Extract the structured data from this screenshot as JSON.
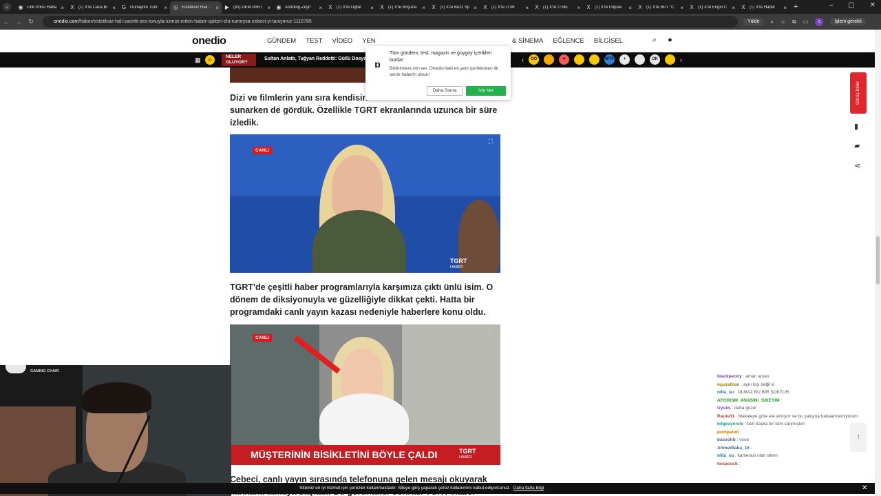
{
  "browser": {
    "tabs": [
      {
        "icon": "◉",
        "title": "Link Polisi Haba"
      },
      {
        "icon": "X",
        "title": "(1) X'te Caca Bi"
      },
      {
        "icon": "G",
        "title": "Günaydın Türk"
      },
      {
        "icon": "◎",
        "title": "Estetiksiz Hali ...",
        "active": true
      },
      {
        "icon": "▶",
        "title": "(91) DEM PART"
      },
      {
        "icon": "◉",
        "title": "Astrolog-Zeyn"
      },
      {
        "icon": "X",
        "title": "(1) X'te Dijital"
      },
      {
        "icon": "X",
        "title": "(1) X'te Boşuna"
      },
      {
        "icon": "X",
        "title": "(1) X'te Buzz Sp"
      },
      {
        "icon": "X",
        "title": "(1) X'te ⭘ Mi"
      },
      {
        "icon": "X",
        "title": "(1) X'te ⭘ Mu"
      },
      {
        "icon": "X",
        "title": "(1) X'te Popule"
      },
      {
        "icon": "X",
        "title": "(1) X'te BPT \"C"
      },
      {
        "icon": "X",
        "title": "(1) X'te Engin C"
      },
      {
        "icon": "X",
        "title": "(1) X'te Haber"
      }
    ],
    "new_tab": "+",
    "url_domain": "onedio.com",
    "url_path": "/haber/estetiksiz-hali-sasirtti-ses-tonuyla-icimizi-eriten-haber-spikeri-ela-rumeysa-cebeci-yi-taniyoruz-1115785",
    "upload_label": "Yükle",
    "profile_initial": "c",
    "pending_label": "İşlem gerekli"
  },
  "site": {
    "logo": "onedio",
    "menu_left": [
      "GÜNDEM",
      "TEST",
      "VİDEO",
      "YEN"
    ],
    "menu_right": [
      "& SİNEMA",
      "EĞLENCE",
      "BİLGİSEL"
    ],
    "neler_label": "NELER OLUYOR?",
    "ticker": "Sultan Anlattı, Tuğyan Reddetti: Güllü Dosyasını",
    "emojis": [
      {
        "label": "OO",
        "color": "#f7c800"
      },
      {
        "label": "",
        "color": "#f7a800"
      },
      {
        "label": "♥",
        "color": "#f25a5a"
      },
      {
        "label": "",
        "color": "#f7c800"
      },
      {
        "label": "",
        "color": "#f7c800"
      },
      {
        "label": "WTF",
        "color": "#2a7fd4"
      },
      {
        "label": "+",
        "color": "#e8e8e8"
      },
      {
        "label": "",
        "color": "#e8e8e8"
      },
      {
        "label": "OK",
        "color": "#e8e8e8"
      },
      {
        "label": "",
        "color": "#f7c800"
      }
    ]
  },
  "popup": {
    "title": "Tüm gündem, test, magazin ve goygoy içerikleri burda!",
    "text": "Bildirimlere izin ver, Onedio'daki en yeni içeriklerden ilk senin haberin olsun!",
    "later_label": "Daha Sonra",
    "allow_label": "İzin Ver"
  },
  "article": {
    "para1": "Dizi ve filmlerin yanı sıra kendisin... sunarken de gördük. Özellikle TGRT ekranlarında uzunca bir süre izledik.",
    "para1_lines": [
      "Dizi ve filmlerin yanı sıra kendisin",
      "sunarken de gördük. Özellikle TGRT ekranlarında uzunca bir süre",
      "izledik."
    ],
    "image1": {
      "badge": "CANLI",
      "channel": "TGRT",
      "channel_sub": "HABER"
    },
    "para2_lines": [
      "TGRT'de çeşitli haber programlarıyla karşımıza çıktı ünlü isim. O",
      "dönem de diksiyonuyla ve güzelliğiyle dikkat çekti. Hatta bir",
      "programdaki canlı yayın kazası nedeniyle haberlere konu oldu."
    ],
    "image2": {
      "badge": "CANLI",
      "banner": "MÜŞTERİNİN BİSİKLETİNİ BÖYLE ÇALDI",
      "channel": "TGRT",
      "channel_sub": "HABER"
    },
    "para3_lines": [
      "Cebeci, canlı yayın sırasında telefonuna gelen mesajı okuyarak",
      "kahkaha atmaya başladı. Bu görüntüler sonrası TGRT Haber"
    ]
  },
  "sidebar": {
    "feedback_label": "Görüş Bildir"
  },
  "stream": {
    "brand_line1": "GAMING CHAIR"
  },
  "chat": [
    {
      "user": "blackpeony",
      "color": "#7a3fb0",
      "msg": "aman aman"
    },
    {
      "user": "oguzathan",
      "color": "#a08000",
      "msg": "aynı kişi değil ki"
    },
    {
      "user": "nilla_su",
      "color": "#2a6fb0",
      "msg": "OLMAZ BU BİR ŞOKTUR"
    },
    {
      "user": "AFORISM_ANASINI_SIKEYIM",
      "color": "#1ea01e",
      "msg": ""
    },
    {
      "user": "Uyuks",
      "color": "#8a3fc0",
      "msg": "daha güzel"
    },
    {
      "user": "Raute31",
      "color": "#c0392b",
      "msg": "Makaleye göre ele alınıyor ve bu çalışma babaannemiyorum"
    },
    {
      "user": "bilgeuyerele",
      "color": "#1a9a8a",
      "msg": "ben başka bir isim sanmıştım"
    },
    {
      "user": "pompareli",
      "color": "#c07a00",
      "msg": ""
    },
    {
      "user": "bassohb",
      "color": "#5a5a9a",
      "msg": "vooo"
    },
    {
      "user": "AhmetBaba_16",
      "color": "#2a6fb0",
      "msg": ""
    },
    {
      "user": "nilla_su",
      "color": "#2a6fb0",
      "msg": "kamerası olan sitem"
    },
    {
      "user": "hesacock",
      "color": "#c0392b",
      "msg": ""
    }
  ],
  "cookie": {
    "text": "Sitemiz en iyi hizmet için çerezler kullanmaktadır. Siteye giriş yaparak çerez kullanımını kabul ediyorsunuz.",
    "link": "Daha fazla bilgi",
    "close": "✕"
  }
}
